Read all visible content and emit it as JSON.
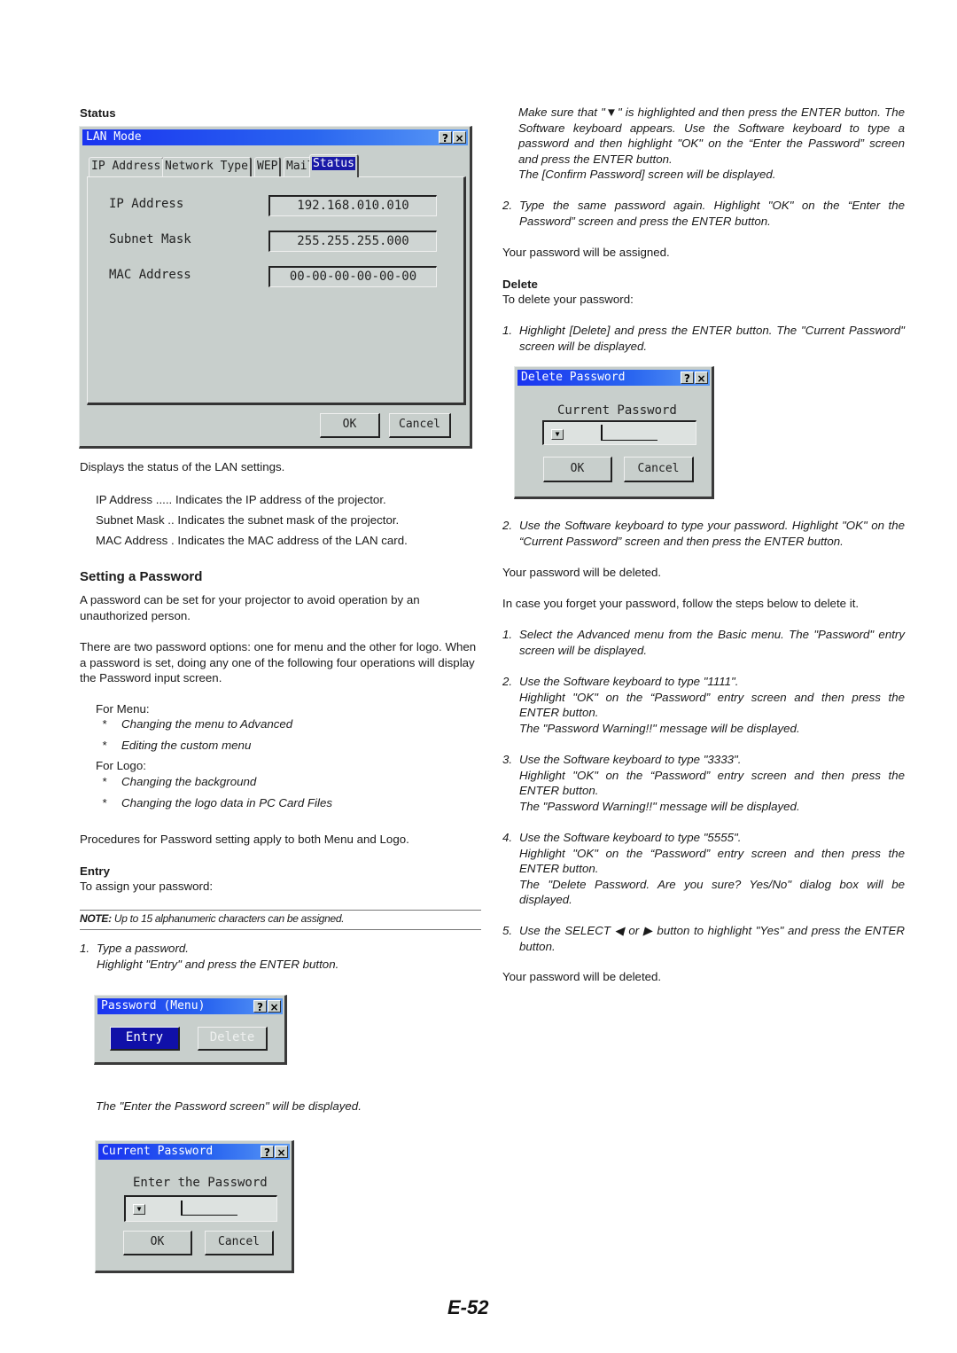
{
  "left": {
    "status_heading": "Status",
    "lan_dialog": {
      "title": "LAN Mode",
      "help_icon": "?",
      "close_icon": "×",
      "tabs": [
        {
          "label": "IP Address",
          "selected": false
        },
        {
          "label": "Network Type",
          "selected": false
        },
        {
          "label": "WEP",
          "selected": false
        },
        {
          "label": "Mail",
          "selected": false
        },
        {
          "label": "Status",
          "selected": true
        }
      ],
      "fields": [
        {
          "label": "IP Address",
          "value": "192.168.010.010"
        },
        {
          "label": "Subnet Mask",
          "value": "255.255.255.000"
        },
        {
          "label": "MAC Address",
          "value": "00-00-00-00-00-00"
        }
      ],
      "ok_label": "OK",
      "cancel_label": "Cancel"
    },
    "status_desc": "Displays the status of the LAN settings.",
    "defs": [
      {
        "term": "IP Address .....",
        "desc": "Indicates the IP address of the projector."
      },
      {
        "term": "Subnet Mask ..",
        "desc": "Indicates the subnet mask of the projector."
      },
      {
        "term": "MAC Address .",
        "desc": "Indicates the MAC address of the LAN card."
      }
    ],
    "setting_heading": "Setting a Password",
    "para1": "A password can be set for your projector to avoid operation by an unauthorized person.",
    "para2": "There are two password options: one for menu and the other for logo. When a password is set, doing any one of the following four operations will display the Password input screen.",
    "for_menu": "For Menu:",
    "menu_items": [
      "Changing the menu to Advanced",
      "Editing the custom menu"
    ],
    "for_logo": "For Logo:",
    "logo_items": [
      "Changing the background",
      "Changing the logo data in PC Card Files"
    ],
    "bullet": "*",
    "procedures": "Procedures for Password setting apply to both Menu and Logo.",
    "entry_heading": "Entry",
    "entry_intro": "To assign your password:",
    "note_label": "NOTE:",
    "note_text": " Up to 15 alphanumeric characters can be assigned.",
    "step1_num": "1.",
    "step1_line1": "Type a password.",
    "step1_line2": "Highlight \"Entry\" and press the ENTER button.",
    "pwd_menu_dialog": {
      "title": "Password (Menu)",
      "entry_label": "Entry",
      "delete_label": "Delete"
    },
    "enter_screen_note": "The \"Enter the Password screen\" will be displayed.",
    "current_pwd_dialog": {
      "title": "Current Password",
      "prompt": "Enter the Password",
      "dropdown_icon": "▼",
      "ok_label": "OK",
      "cancel_label": "Cancel"
    }
  },
  "right": {
    "cont_para": "Make sure that \"▼\" is highlighted and then press the ENTER button. The Software keyboard appears. Use the Software keyboard to type a password and then highlight \"OK\" on the “Enter the Password” screen and press the ENTER button.",
    "cont_para2": "The [Confirm Password] screen will be displayed.",
    "step2_num": "2.",
    "step2": "Type the same password again. Highlight \"OK\" on the “Enter the Password” screen and press the ENTER button.",
    "assigned": "Your password will be assigned.",
    "delete_heading": "Delete",
    "delete_intro": "To delete your password:",
    "del_step1_num": "1.",
    "del_step1": "Highlight [Delete] and press the ENTER button. The \"Current Password\" screen will be displayed.",
    "delete_dialog": {
      "title": "Delete Password",
      "prompt": "Current Password",
      "dropdown_icon": "▼",
      "ok_label": "OK",
      "cancel_label": "Cancel"
    },
    "del_step2_num": "2.",
    "del_step2": "Use the Software keyboard to type your password. Highlight \"OK\" on the “Current Password” screen and then press the ENTER button.",
    "deleted1": "Your password will be deleted.",
    "forget": "In case you forget your password, follow the steps below to delete it.",
    "forget_steps": [
      {
        "num": "1.",
        "lines": [
          "Select the Advanced menu from the Basic menu. The \"Password\" entry screen will be displayed."
        ]
      },
      {
        "num": "2.",
        "lines": [
          "Use the Software keyboard to type \"1111\".",
          "Highlight \"OK\" on the “Password” entry screen and then press the ENTER button.",
          "The \"Password Warning!!\" message will be displayed."
        ]
      },
      {
        "num": "3.",
        "lines": [
          "Use the Software keyboard to type \"3333\".",
          "Highlight \"OK\" on the “Password” entry screen and then press the ENTER button.",
          "The \"Password Warning!!\" message will be displayed."
        ]
      },
      {
        "num": "4.",
        "lines": [
          "Use the Software keyboard to type \"5555\".",
          "Highlight \"OK\" on the “Password” entry screen and then press the ENTER button.",
          "The \"Delete Password. Are you sure? Yes/No\" dialog box will be displayed."
        ]
      },
      {
        "num": "5.",
        "lines": [
          "Use the SELECT ◀ or ▶ button to highlight \"Yes\" and press the ENTER button."
        ]
      }
    ],
    "deleted2": "Your password will be deleted."
  },
  "page_number": "E-52"
}
